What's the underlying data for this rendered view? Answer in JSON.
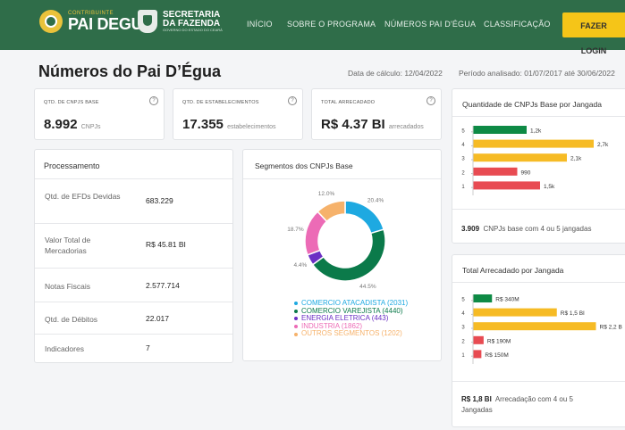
{
  "header": {
    "brand_small": "CONTRIBUINTE",
    "brand_name": "PAI DEGUA",
    "secretaria_line1": "SECRETARIA",
    "secretaria_line2": "DA FAZENDA",
    "secretaria_line3": "GOVERNO DO ESTADO DO CEARÁ",
    "nav": [
      "INÍCIO",
      "SOBRE O PROGRAMA",
      "NÚMEROS PAI D'ÉGUA",
      "CLASSIFICAÇÃO"
    ],
    "login_label": "FAZER LOGIN",
    "colors": {
      "bar": "#2f6d49",
      "accent": "#f5c518"
    }
  },
  "page": {
    "title": "Números do Pai D’Égua",
    "calc_date": "Data de cálculo: 12/04/2022",
    "period": "Período analisado: 01/07/2017 até 30/06/2022"
  },
  "stats": [
    {
      "title": "QTD. DE CNPJS BASE",
      "value": "8.992",
      "unit": "CNPJs",
      "help": "?"
    },
    {
      "title": "QTD. DE ESTABELECIMENTOS",
      "value": "17.355",
      "unit": "estabelecimentos",
      "help": "?"
    },
    {
      "title": "TOTAL ARRECADADO",
      "value": "R$ 4.37 BI",
      "unit": "arrecadados",
      "help": "?"
    }
  ],
  "processamento": {
    "title": "Processamento",
    "rows": [
      {
        "label": "Qtd. de EFDs Devidas",
        "value": "683.229"
      },
      {
        "label": "Valor Total de Mercadorias",
        "value": "R$ 45.81 BI"
      },
      {
        "label": "Notas Fiscais",
        "value": "2.577.714"
      },
      {
        "label": "Qtd. de Débitos",
        "value": "22.017"
      },
      {
        "label": "Indicadores",
        "value": "7"
      }
    ]
  },
  "segmentos": {
    "title": "Segmentos dos CNPJs Base",
    "chart_data": {
      "type": "pie",
      "slices": [
        {
          "label": "COMERCIO ATACADISTA (2031)",
          "value": 20.4,
          "color": "#1ea9e1"
        },
        {
          "label": "COMERCIO VAREJISTA (4440)",
          "value": 44.5,
          "color": "#0b7a4a"
        },
        {
          "label": "ENERGIA ELETRICA (443)",
          "value": 4.4,
          "color": "#6b2fc4"
        },
        {
          "label": "INDUSTRIA (1862)",
          "value": 18.7,
          "color": "#ec6bb6"
        },
        {
          "label": "OUTROS SEGMENTOS (1202)",
          "value": 12.0,
          "color": "#f6b26b"
        }
      ],
      "labels": [
        "20.4%",
        "44.5%",
        "4.4%",
        "18.7%",
        "12.0%"
      ]
    }
  },
  "cnpj_jangada": {
    "title": "Quantidade de CNPJs Base por Jangada",
    "chart_data": {
      "type": "bar",
      "categories": [
        "5",
        "4",
        "3",
        "2",
        "1"
      ],
      "values": [
        1200,
        2700,
        2100,
        990,
        1500
      ],
      "value_labels": [
        "1,2k",
        "2,7k",
        "2,1k",
        "990",
        "1,5k"
      ],
      "colors": [
        "#0e8a45",
        "#f6bb25",
        "#f6bb25",
        "#e84b52",
        "#e84b52"
      ],
      "max": 3000
    },
    "note_value": "3.909",
    "note_text": "CNPJs base com 4 ou 5 jangadas"
  },
  "arrecadado_jangada": {
    "title": "Total Arrecadado por Jangada",
    "chart_data": {
      "type": "bar",
      "categories": [
        "5",
        "4",
        "3",
        "2",
        "1"
      ],
      "values": [
        340,
        1500,
        2200,
        190,
        150
      ],
      "value_labels": [
        "R$ 340M",
        "R$ 1,5 BI",
        "R$ 2,2 B",
        "R$ 190M",
        "R$ 150M"
      ],
      "colors": [
        "#0e8a45",
        "#f6bb25",
        "#f6bb25",
        "#e84b52",
        "#e84b52"
      ],
      "max": 2400
    },
    "note_value": "R$ 1,8 BI",
    "note_text": "Arrecadação com 4 ou 5 Jangadas"
  }
}
